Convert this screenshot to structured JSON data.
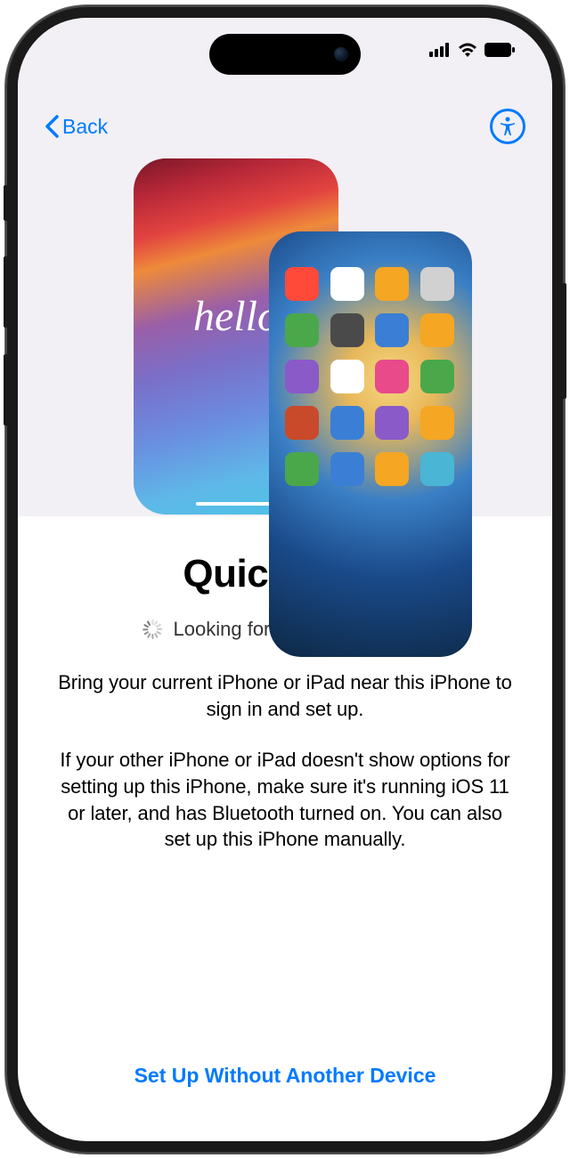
{
  "nav": {
    "back_label": "Back"
  },
  "hero": {
    "hello_text": "hello",
    "app_icon_colors": [
      "#ff4a3a",
      "#ffffff",
      "#f5a623",
      "#d1d1d1",
      "#4aa84a",
      "#4a4a4a",
      "#3a7fd5",
      "#f5a623",
      "#8a5ac8",
      "#ffffff",
      "#e84a8a",
      "#4aa84a",
      "#c84a2a",
      "#3a7fd5",
      "#8a5ac8",
      "#f5a623",
      "#4aa84a",
      "#3a7fd5",
      "#f5a623",
      "#4ab5d5"
    ]
  },
  "content": {
    "title": "Quick Start",
    "status": "Looking for nearby devices…",
    "paragraph1": "Bring your current iPhone or iPad near this iPhone to sign in and set up.",
    "paragraph2": "If your other iPhone or iPad doesn't show options for setting up this iPhone, make sure it's running iOS 11 or later, and has Bluetooth turned on. You can also set up this iPhone manually."
  },
  "footer": {
    "link_label": "Set Up Without Another Device"
  },
  "colors": {
    "accent": "#007aff"
  }
}
